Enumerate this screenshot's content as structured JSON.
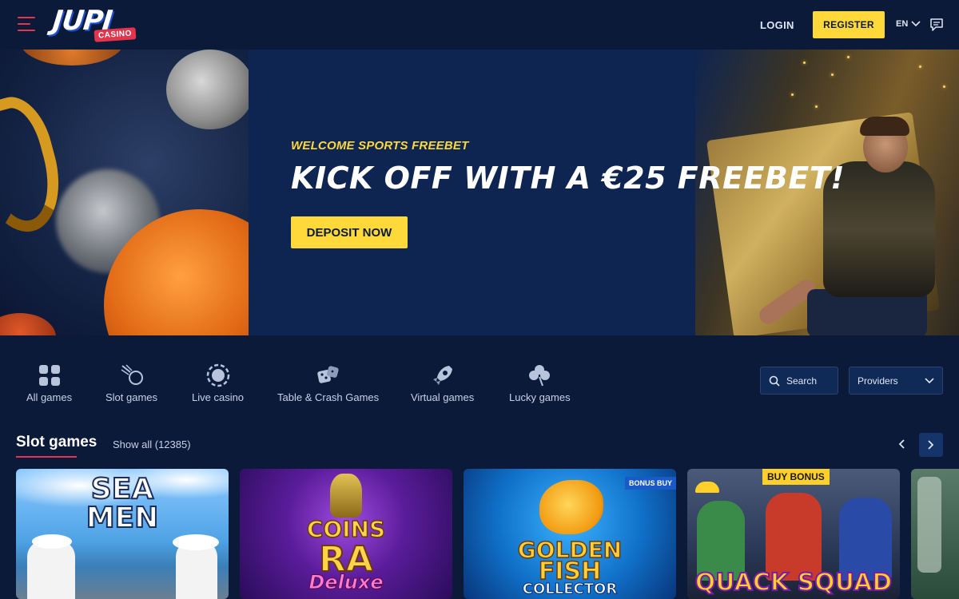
{
  "header": {
    "logo_text": "JUPI",
    "logo_badge": "CASINO",
    "login_label": "LOGIN",
    "register_label": "REGISTER",
    "language": "EN"
  },
  "hero": {
    "subtitle": "WELCOME SPORTS FREEBET",
    "title": "KICK OFF WITH A €25 FREEBET!",
    "cta_label": "DEPOSIT NOW"
  },
  "categories": [
    {
      "label": "All games",
      "icon": "grid-icon"
    },
    {
      "label": "Slot games",
      "icon": "slot-meteor-icon"
    },
    {
      "label": "Live casino",
      "icon": "live-chip-icon"
    },
    {
      "label": "Table & Crash Games",
      "icon": "dice-icon"
    },
    {
      "label": "Virtual games",
      "icon": "rocket-icon"
    },
    {
      "label": "Lucky games",
      "icon": "clover-icon"
    }
  ],
  "filters": {
    "search_label": "Search",
    "providers_label": "Providers"
  },
  "section": {
    "title": "Slot games",
    "show_all": "Show all (12385)"
  },
  "games": [
    {
      "title_line1": "SEA",
      "title_line2": "MEN",
      "badge": ""
    },
    {
      "title_line1": "COINS",
      "title_line2": "RA",
      "title_line3": "Deluxe",
      "badge": ""
    },
    {
      "title_line1": "GOLDEN",
      "title_line2": "FISH",
      "title_line3": "COLLECTOR",
      "badge": "BONUS BUY"
    },
    {
      "title_line1": "QUACK SQUAD",
      "badge": "BUY BONUS"
    }
  ],
  "colors": {
    "background": "#0c1a3a",
    "accent_yellow": "#ffd93a",
    "accent_red": "#e2344c"
  }
}
